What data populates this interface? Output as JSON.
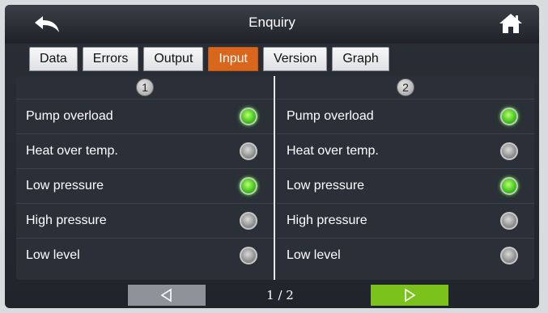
{
  "window": {
    "title": "Enquiry",
    "back_icon": "back-arrow-icon",
    "home_icon": "home-icon"
  },
  "tabs": [
    {
      "label": "Data",
      "active": false
    },
    {
      "label": "Errors",
      "active": false
    },
    {
      "label": "Output",
      "active": false
    },
    {
      "label": "Input",
      "active": true
    },
    {
      "label": "Version",
      "active": false
    },
    {
      "label": "Graph",
      "active": false
    }
  ],
  "columns": [
    {
      "header": "1",
      "rows": [
        {
          "label": "Pump overload",
          "status": "on"
        },
        {
          "label": "Heat over temp.",
          "status": "off"
        },
        {
          "label": "Low pressure",
          "status": "on"
        },
        {
          "label": "High pressure",
          "status": "off"
        },
        {
          "label": "Low level",
          "status": "off"
        }
      ]
    },
    {
      "header": "2",
      "rows": [
        {
          "label": "Pump overload",
          "status": "on"
        },
        {
          "label": "Heat over temp.",
          "status": "off"
        },
        {
          "label": "Low pressure",
          "status": "on"
        },
        {
          "label": "High pressure",
          "status": "off"
        },
        {
          "label": "Low level",
          "status": "off"
        }
      ]
    }
  ],
  "pager": {
    "indicator": "1 / 2",
    "prev_icon": "triangle-left-icon",
    "next_icon": "triangle-right-icon"
  },
  "colors": {
    "active_tab": "#d9661c",
    "led_on": "#3ec11a",
    "led_off": "#8f8f8f",
    "next_button": "#7cc21d",
    "prev_button": "#8f9298"
  }
}
